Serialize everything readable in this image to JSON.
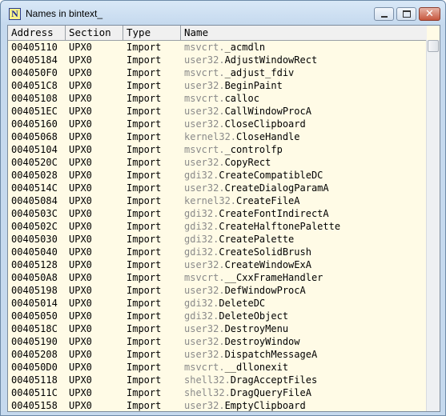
{
  "window": {
    "title": "Names in bintext_",
    "app_icon_letter": "N",
    "close_glyph": "✕"
  },
  "table": {
    "columns": [
      "Address",
      "Section",
      "Type",
      "Name"
    ],
    "rows": [
      {
        "address": "00405110",
        "section": "UPX0",
        "type": "Import",
        "lib": "msvcrt.",
        "func": "_acmdln"
      },
      {
        "address": "00405184",
        "section": "UPX0",
        "type": "Import",
        "lib": "user32.",
        "func": "AdjustWindowRect"
      },
      {
        "address": "004050F0",
        "section": "UPX0",
        "type": "Import",
        "lib": "msvcrt.",
        "func": "_adjust_fdiv"
      },
      {
        "address": "004051C8",
        "section": "UPX0",
        "type": "Import",
        "lib": "user32.",
        "func": "BeginPaint"
      },
      {
        "address": "00405108",
        "section": "UPX0",
        "type": "Import",
        "lib": "msvcrt.",
        "func": "calloc"
      },
      {
        "address": "004051EC",
        "section": "UPX0",
        "type": "Import",
        "lib": "user32.",
        "func": "CallWindowProcA"
      },
      {
        "address": "00405160",
        "section": "UPX0",
        "type": "Import",
        "lib": "user32.",
        "func": "CloseClipboard"
      },
      {
        "address": "00405068",
        "section": "UPX0",
        "type": "Import",
        "lib": "kernel32.",
        "func": "CloseHandle"
      },
      {
        "address": "00405104",
        "section": "UPX0",
        "type": "Import",
        "lib": "msvcrt.",
        "func": "_controlfp"
      },
      {
        "address": "0040520C",
        "section": "UPX0",
        "type": "Import",
        "lib": "user32.",
        "func": "CopyRect"
      },
      {
        "address": "00405028",
        "section": "UPX0",
        "type": "Import",
        "lib": "gdi32.",
        "func": "CreateCompatibleDC"
      },
      {
        "address": "0040514C",
        "section": "UPX0",
        "type": "Import",
        "lib": "user32.",
        "func": "CreateDialogParamA"
      },
      {
        "address": "00405084",
        "section": "UPX0",
        "type": "Import",
        "lib": "kernel32.",
        "func": "CreateFileA"
      },
      {
        "address": "0040503C",
        "section": "UPX0",
        "type": "Import",
        "lib": "gdi32.",
        "func": "CreateFontIndirectA"
      },
      {
        "address": "0040502C",
        "section": "UPX0",
        "type": "Import",
        "lib": "gdi32.",
        "func": "CreateHalftonePalette"
      },
      {
        "address": "00405030",
        "section": "UPX0",
        "type": "Import",
        "lib": "gdi32.",
        "func": "CreatePalette"
      },
      {
        "address": "00405040",
        "section": "UPX0",
        "type": "Import",
        "lib": "gdi32.",
        "func": "CreateSolidBrush"
      },
      {
        "address": "00405128",
        "section": "UPX0",
        "type": "Import",
        "lib": "user32.",
        "func": "CreateWindowExA"
      },
      {
        "address": "004050A8",
        "section": "UPX0",
        "type": "Import",
        "lib": "msvcrt.",
        "func": "__CxxFrameHandler"
      },
      {
        "address": "00405198",
        "section": "UPX0",
        "type": "Import",
        "lib": "user32.",
        "func": "DefWindowProcA"
      },
      {
        "address": "00405014",
        "section": "UPX0",
        "type": "Import",
        "lib": "gdi32.",
        "func": "DeleteDC"
      },
      {
        "address": "00405050",
        "section": "UPX0",
        "type": "Import",
        "lib": "gdi32.",
        "func": "DeleteObject"
      },
      {
        "address": "0040518C",
        "section": "UPX0",
        "type": "Import",
        "lib": "user32.",
        "func": "DestroyMenu"
      },
      {
        "address": "00405190",
        "section": "UPX0",
        "type": "Import",
        "lib": "user32.",
        "func": "DestroyWindow"
      },
      {
        "address": "00405208",
        "section": "UPX0",
        "type": "Import",
        "lib": "user32.",
        "func": "DispatchMessageA"
      },
      {
        "address": "004050D0",
        "section": "UPX0",
        "type": "Import",
        "lib": "msvcrt.",
        "func": "__dllonexit"
      },
      {
        "address": "00405118",
        "section": "UPX0",
        "type": "Import",
        "lib": "shell32.",
        "func": "DragAcceptFiles"
      },
      {
        "address": "0040511C",
        "section": "UPX0",
        "type": "Import",
        "lib": "shell32.",
        "func": "DragQueryFileA"
      },
      {
        "address": "00405158",
        "section": "UPX0",
        "type": "Import",
        "lib": "user32.",
        "func": "EmptyClipboard"
      }
    ]
  }
}
